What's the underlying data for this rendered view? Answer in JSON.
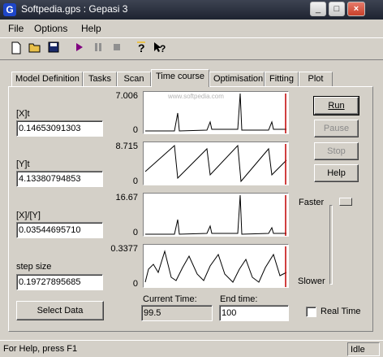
{
  "window": {
    "title": "Softpedia.gps : Gepasi 3",
    "app_icon": "G"
  },
  "menu": [
    "File",
    "Options",
    "Help"
  ],
  "tabs": [
    "Model Definition",
    "Tasks",
    "Scan",
    "Time course",
    "Optimisation",
    "Fitting",
    "Plot"
  ],
  "active_tab": "Time course",
  "variables": [
    {
      "label": "[X]t",
      "value": "0.14653091303"
    },
    {
      "label": "[Y]t",
      "value": "4.13380794853"
    },
    {
      "label": "[X]/[Y]",
      "value": "0.03544695710"
    },
    {
      "label": "step size",
      "value": "0.19727895685"
    }
  ],
  "plots": [
    {
      "ymax": "7.006",
      "ymin": "0"
    },
    {
      "ymax": "8.715",
      "ymin": "0"
    },
    {
      "ymax": "16.67",
      "ymin": "0"
    },
    {
      "ymax": "0.3377",
      "ymin": "0"
    }
  ],
  "buttons": {
    "run": "Run",
    "pause": "Pause",
    "stop": "Stop",
    "help": "Help",
    "select_data": "Select Data"
  },
  "speed": {
    "faster": "Faster",
    "slower": "Slower"
  },
  "time": {
    "current_label": "Current Time:",
    "current_value": "99.5",
    "end_label": "End time:",
    "end_value": "100"
  },
  "realtime_label": "Real Time",
  "status": {
    "message": "For Help, press F1",
    "state": "Idle"
  },
  "watermark": "www.softpedia.com",
  "colors": {
    "plot_line": "#000000",
    "time_marker": "#c00000"
  }
}
